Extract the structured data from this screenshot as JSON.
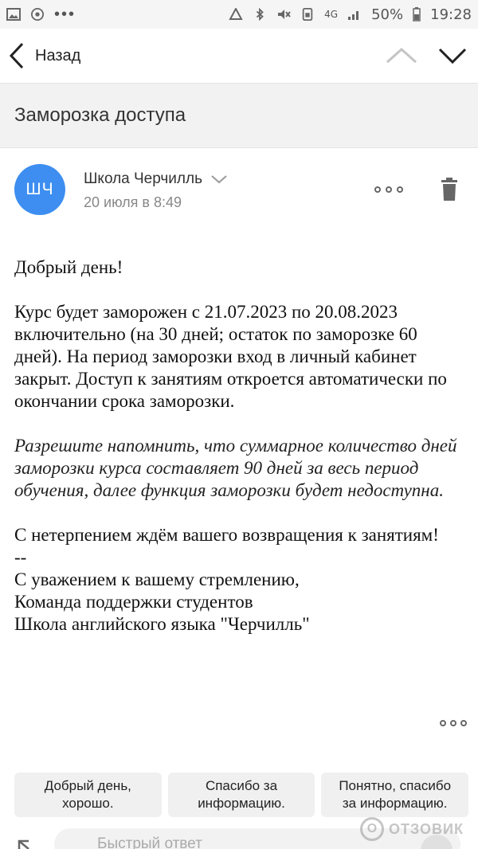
{
  "status_bar": {
    "icons_left": [
      "gallery-icon",
      "chrome-icon"
    ],
    "dots": "•••",
    "icons_right": [
      "recycle-icon",
      "bluetooth-icon",
      "mute-icon",
      "sim-icon",
      "signal-icon"
    ],
    "network": "4G",
    "battery": "50%",
    "time": "19:28"
  },
  "toolbar": {
    "back_label": "Назад"
  },
  "email": {
    "subject": "Заморозка доступа",
    "sender": {
      "initials": "ШЧ",
      "name": "Школа Черчилль",
      "date": "20 июля в 8:49",
      "avatar_color": "#3d8ef0"
    },
    "body": {
      "greeting": "Добрый день!",
      "paragraph1": "Курс будет заморожен с 21.07.2023 по 20.08.2023 включительно (на 30 дней; остаток по заморозке 60 дней). На период заморозки вход в личный кабинет закрыт. Доступ к занятиям откроется автоматически по окончании срока заморозки.",
      "paragraph2": "Разрешите напомнить, что суммарное количество дней заморозки курса составляет 90 дней за весь период обучения, далее функция заморозки будет недоступна.",
      "paragraph3": "С нетерпением ждём вашего возвращения к занятиям!",
      "separator": "--",
      "sign1": "С уважением к вашему стремлению,",
      "sign2": "Команда поддержки студентов",
      "sign3": "Школа английского языка \"Черчилль\""
    }
  },
  "quick_replies": [
    {
      "line1": "Добрый день,",
      "line2": "хорошо."
    },
    {
      "line1": "Спасибо за",
      "line2": "информацию."
    },
    {
      "line1": "Понятно, спасибо",
      "line2": "за информацию."
    }
  ],
  "reply": {
    "placeholder": "Быстрый ответ"
  },
  "watermark": {
    "text": "ОТЗОВИК"
  }
}
